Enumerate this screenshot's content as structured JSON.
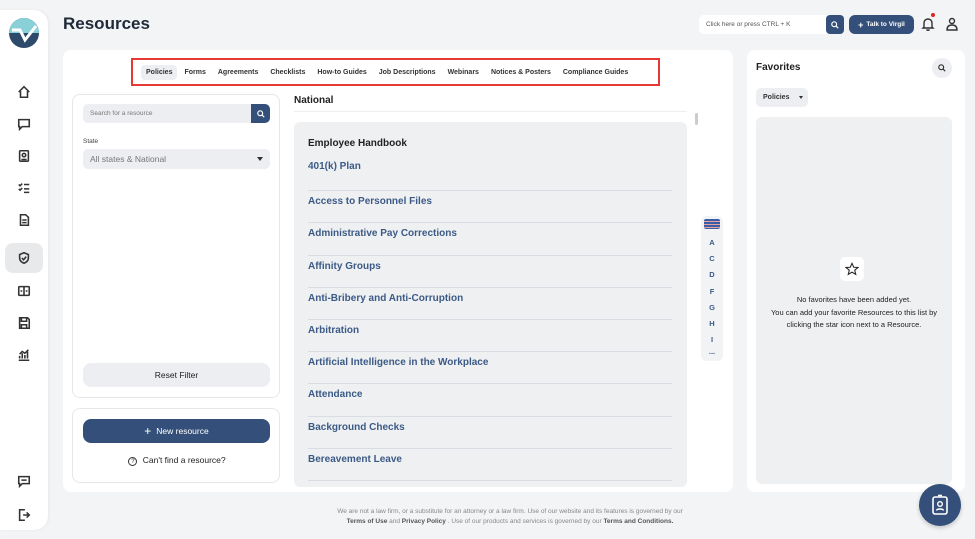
{
  "header": {
    "title": "Resources",
    "search_placeholder": "Click here or press CTRL + K",
    "talk_button": "Talk to Virgil"
  },
  "tabs": [
    {
      "label": "Policies",
      "active": true
    },
    {
      "label": "Forms"
    },
    {
      "label": "Agreements"
    },
    {
      "label": "Checklists"
    },
    {
      "label": "How-to Guides"
    },
    {
      "label": "Job Descriptions"
    },
    {
      "label": "Webinars"
    },
    {
      "label": "Notices & Posters"
    },
    {
      "label": "Compliance Guides"
    }
  ],
  "filters": {
    "search_placeholder": "Search for a resource",
    "state_label": "State",
    "state_value": "All states & National",
    "reset_label": "Reset Filter",
    "new_resource_label": "New resource",
    "cant_find_label": "Can't find a resource?"
  },
  "list": {
    "section_title": "National",
    "group_title": "Employee Handbook",
    "items": [
      "401(k) Plan",
      "Access to Personnel Files",
      "Administrative Pay Corrections",
      "Affinity Groups",
      "Anti-Bribery and Anti-Corruption",
      "Arbitration",
      "Artificial Intelligence in the Workplace",
      "Attendance",
      "Background Checks",
      "Bereavement Leave"
    ]
  },
  "alphabet": [
    "A",
    "C",
    "D",
    "F",
    "G",
    "H",
    "I",
    "..."
  ],
  "favorites": {
    "title": "Favorites",
    "dropdown": "Policies",
    "empty_title": "No favorites have been added yet.",
    "empty_body": "You can add your favorite Resources to this list by clicking the star icon next to a Resource."
  },
  "footer": {
    "line1": "We are not a law firm, or a substitute for an attorney or a law firm. Use of our website and its features is governed by our",
    "terms_of_use": "Terms of Use",
    "and": "and",
    "privacy": "Privacy Policy",
    "line2_mid": ". Use of our products and services is governed by our",
    "terms_conditions": "Terms and Conditions."
  },
  "colors": {
    "primary": "#34507a",
    "link": "#3c5a86",
    "highlight_border": "#e53935",
    "notification_dot": "#e02424"
  }
}
